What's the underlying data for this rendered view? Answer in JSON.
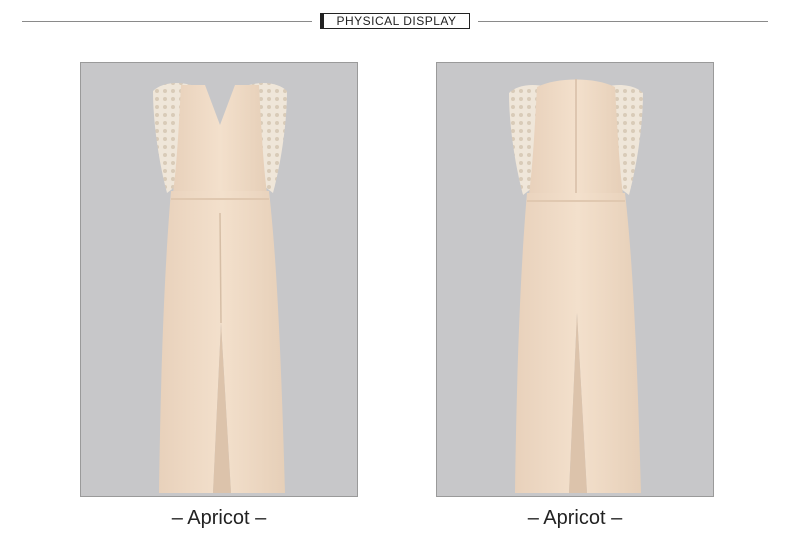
{
  "header": {
    "title": "PHYSICAL DISPLAY"
  },
  "photos": [
    {
      "view": "front",
      "caption": "– Apricot –"
    },
    {
      "view": "back",
      "caption": "– Apricot –"
    }
  ],
  "colors": {
    "photo_background": "#c7c7c9",
    "garment": "#f1dcc6",
    "garment_shadow": "#e2c8ae",
    "lace": "#efe6d9"
  }
}
